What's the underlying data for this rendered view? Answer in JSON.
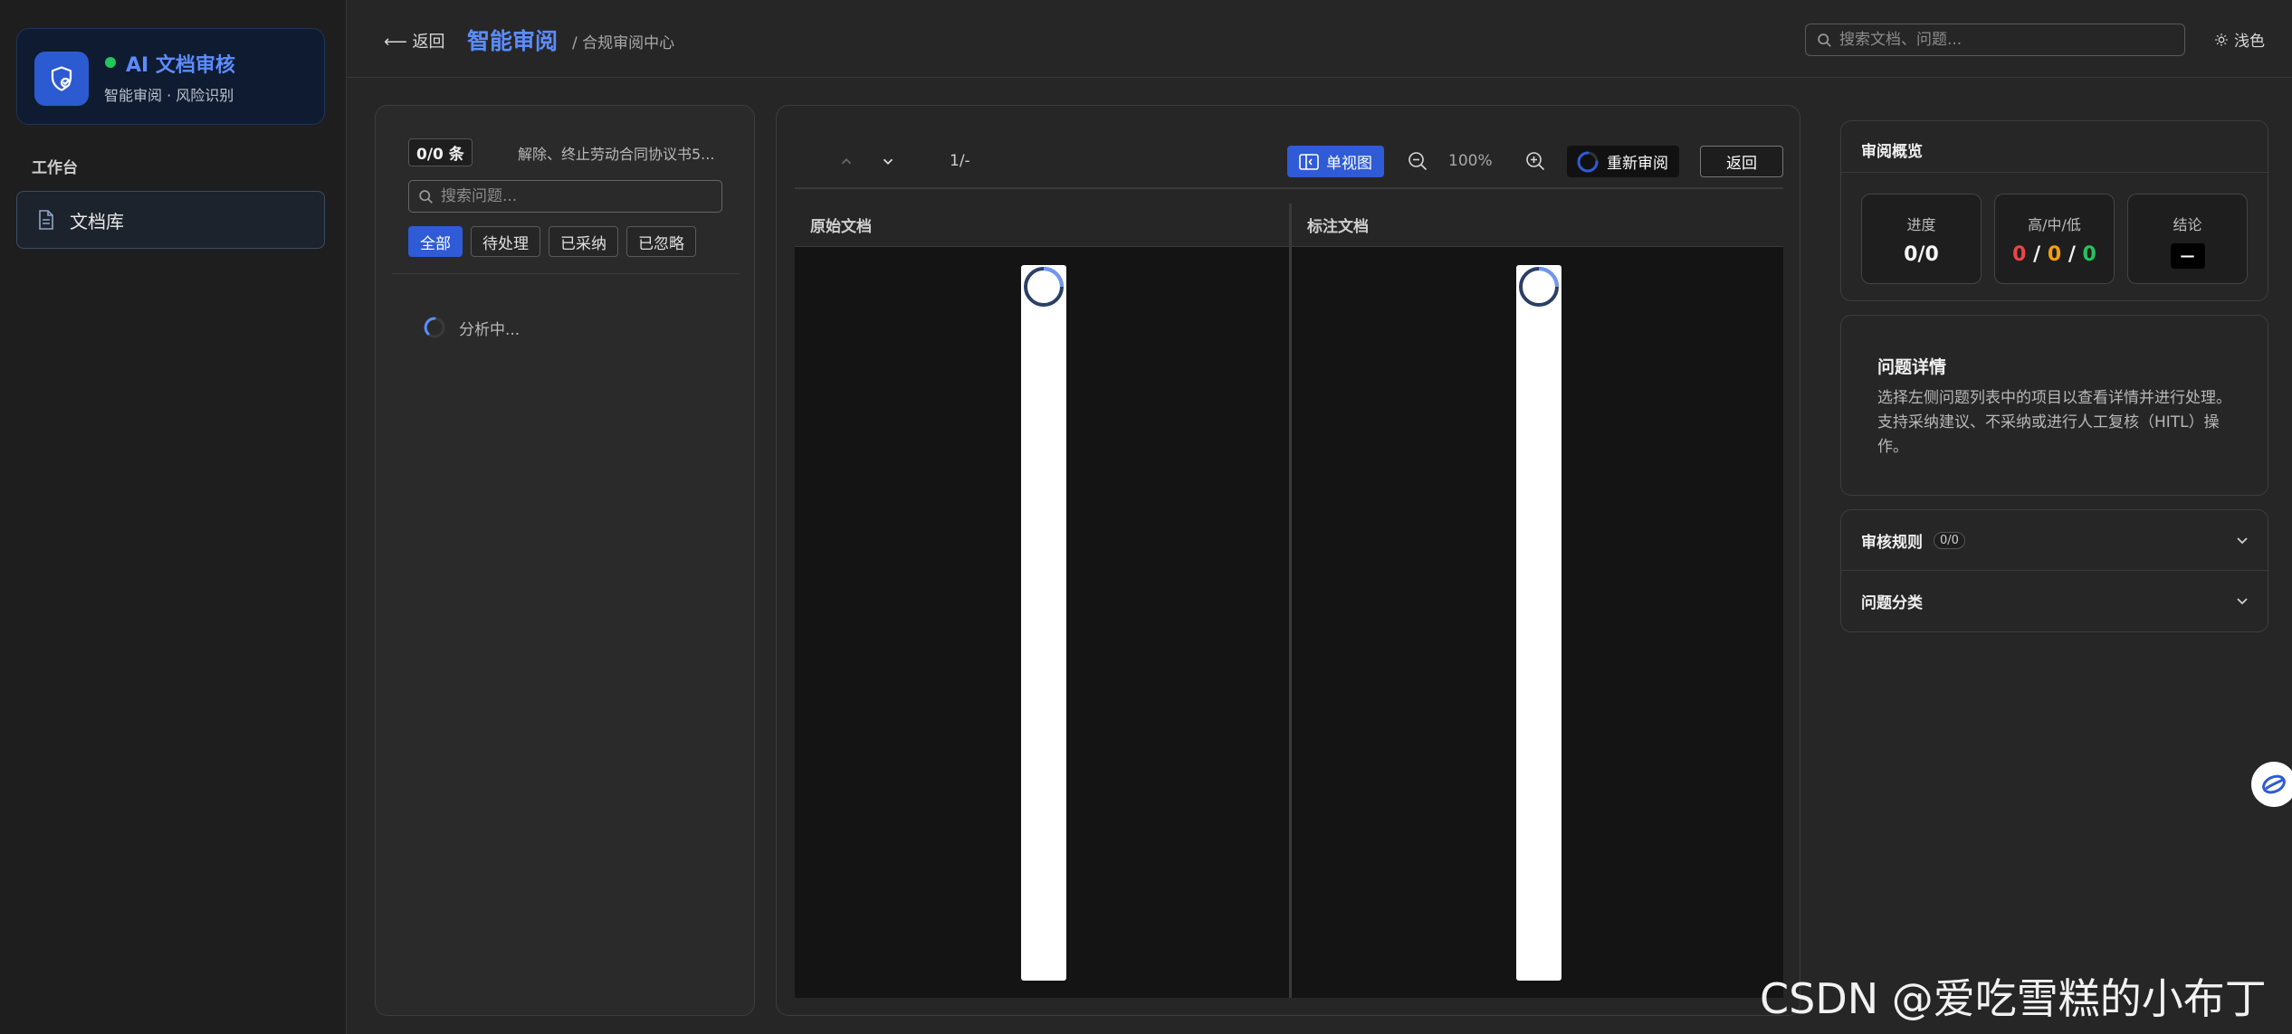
{
  "brand": {
    "title": "AI 文档审核",
    "subtitle": "智能审阅 · 风险识别"
  },
  "sidebar": {
    "section_title": "工作台",
    "items": [
      {
        "label": "文档库",
        "icon": "document-icon"
      }
    ]
  },
  "header": {
    "back_label": "返回",
    "title": "智能审阅",
    "breadcrumb": "/ 合规审阅中心",
    "search_placeholder": "搜索文档、问题...",
    "theme_label": "浅色"
  },
  "issues": {
    "count_label": "0/0 条",
    "document_name": "解除、终止劳动合同协议书5...",
    "search_placeholder": "搜索问题...",
    "filters": [
      {
        "label": "全部",
        "active": true
      },
      {
        "label": "待处理",
        "active": false
      },
      {
        "label": "已采纳",
        "active": false
      },
      {
        "label": "已忽略",
        "active": false
      }
    ],
    "loading_text": "分析中..."
  },
  "viewer": {
    "page_indicator": "1/-",
    "single_view_label": "单视图",
    "zoom_level": "100%",
    "rereview_label": "重新审阅",
    "return_label": "返回",
    "panes": [
      {
        "title": "原始文档"
      },
      {
        "title": "标注文档"
      }
    ]
  },
  "overview": {
    "title": "审阅概览",
    "progress": {
      "label": "进度",
      "value": "0/0"
    },
    "risk": {
      "label": "高/中/低",
      "high": "0",
      "mid": "0",
      "low": "0",
      "separator": "/"
    },
    "verdict": {
      "label": "结论",
      "value": "—"
    }
  },
  "detail": {
    "title": "问题详情",
    "body": "选择左侧问题列表中的项目以查看详情并进行处理。 支持采纳建议、不采纳或进行人工复核（HITL）操作。"
  },
  "sections": [
    {
      "label": "审核规则",
      "count": "0/0"
    },
    {
      "label": "问题分类"
    }
  ],
  "colors": {
    "accent": "#2f5bd6",
    "brand_text": "#5b8cff",
    "risk_high": "#ef4444",
    "risk_mid": "#f59e0b",
    "risk_low": "#22c55e"
  },
  "watermark": "CSDN @爱吃雪糕的小布丁"
}
